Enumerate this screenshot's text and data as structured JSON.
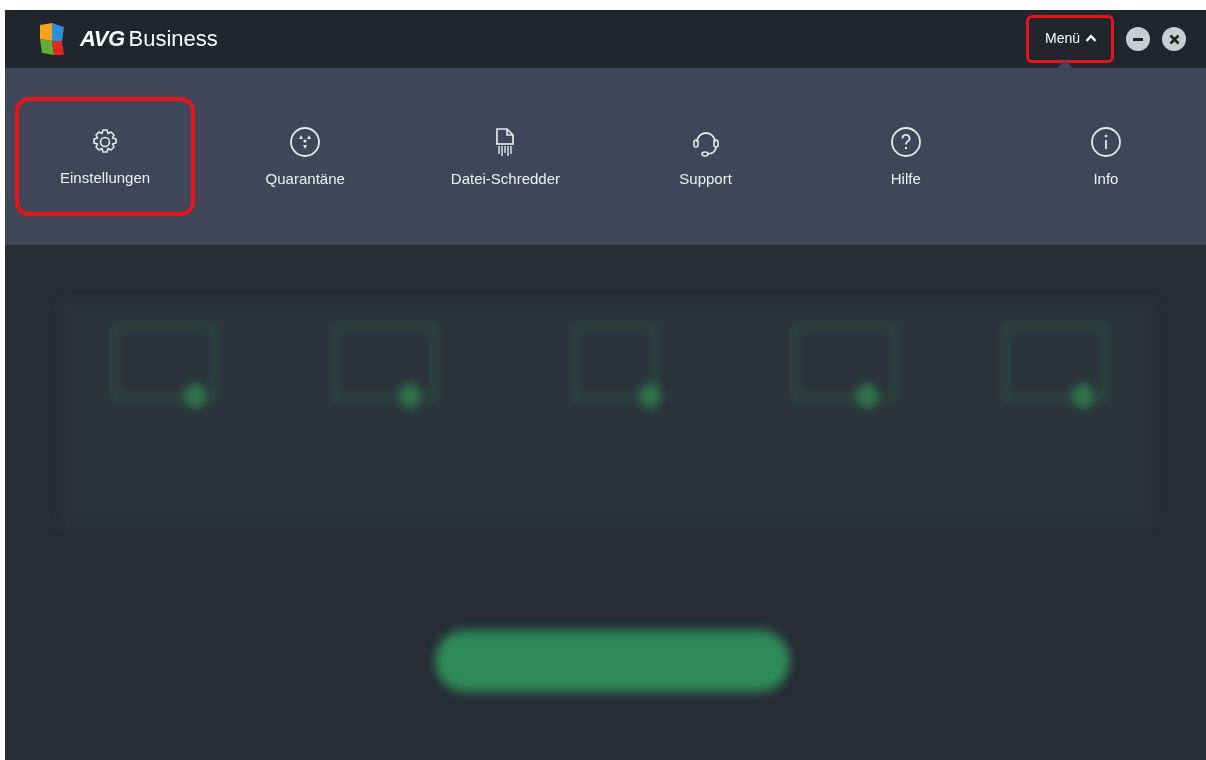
{
  "window": {
    "brand": "AVG",
    "product": "Business"
  },
  "menu_button": {
    "label": "Menü",
    "expanded": true,
    "highlighted": true
  },
  "menu_items": [
    {
      "kind": "gear",
      "label": "Einstellungen",
      "highlighted": true
    },
    {
      "kind": "quarantine",
      "label": "Quarantäne",
      "highlighted": false
    },
    {
      "kind": "shredder",
      "label": "Datei-Schredder",
      "highlighted": false
    },
    {
      "kind": "headset",
      "label": "Support",
      "highlighted": false
    },
    {
      "kind": "help",
      "label": "Hilfe",
      "highlighted": false
    },
    {
      "kind": "info",
      "label": "Info",
      "highlighted": false
    }
  ]
}
